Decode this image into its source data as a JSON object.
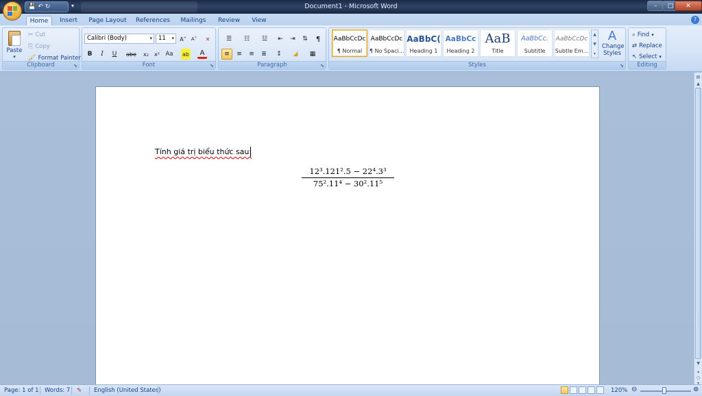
{
  "window": {
    "title": "Document1 - Microsoft Word",
    "controls": {
      "minimize": "–",
      "maximize": "□",
      "close": "✕"
    }
  },
  "quick_access": {
    "save_icon": "💾",
    "undo_icon": "↶",
    "redo_icon": "↻"
  },
  "tabs": [
    "Home",
    "Insert",
    "Page Layout",
    "References",
    "Mailings",
    "Review",
    "View"
  ],
  "active_tab": "Home",
  "clipboard": {
    "paste": "Paste",
    "cut": "Cut",
    "copy": "Copy",
    "format_painter": "Format Painter",
    "label": "Clipboard"
  },
  "font": {
    "family": "Calibri (Body)",
    "size": "11",
    "grow": "A˄",
    "shrink": "A˅",
    "clear": "✕",
    "bold": "B",
    "italic": "I",
    "underline": "U",
    "strike": "abe",
    "subscript": "x₂",
    "superscript": "x²",
    "change_case": "Aa",
    "highlight": "ab",
    "font_color": "A",
    "label": "Font"
  },
  "paragraph": {
    "label": "Paragraph",
    "show_marks": "¶"
  },
  "styles": {
    "label": "Styles",
    "items": [
      {
        "sample": "AaBbCcDc",
        "name": "¶ Normal"
      },
      {
        "sample": "AaBbCcDc",
        "name": "¶ No Spaci..."
      },
      {
        "sample": "AaBbC(",
        "name": "Heading 1"
      },
      {
        "sample": "AaBbCc",
        "name": "Heading 2"
      },
      {
        "sample": "AaB",
        "name": "Title"
      },
      {
        "sample": "AaBbCc.",
        "name": "Subtitle"
      },
      {
        "sample": "AaBbCcDc",
        "name": "Subtle Em..."
      }
    ],
    "change_styles_line1": "Change",
    "change_styles_line2": "Styles"
  },
  "editing": {
    "find": "Find",
    "replace": "Replace",
    "select": "Select",
    "label": "Editing"
  },
  "document": {
    "line1": "Tính giá trị biểu thức sau:",
    "numerator": "12³.121².5 − 22⁴.3³",
    "denominator": "75².11⁴ − 30².11⁵"
  },
  "status": {
    "page": "Page: 1 of 1",
    "words": "Words: 7",
    "language": "English (United States)",
    "zoom": "120%"
  }
}
